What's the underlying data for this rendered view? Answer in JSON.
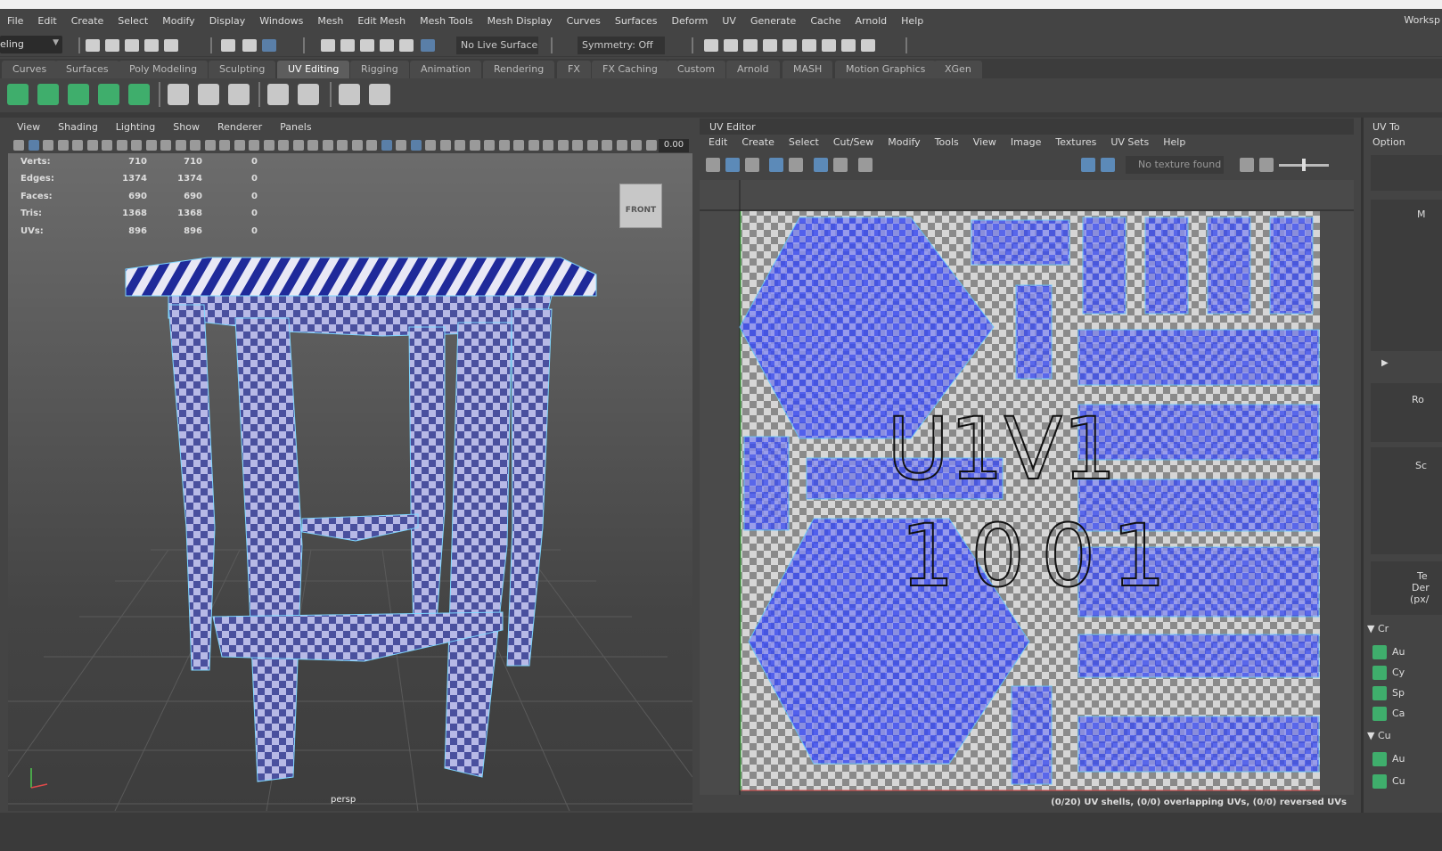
{
  "menubar": {
    "items": [
      "File",
      "Edit",
      "Create",
      "Select",
      "Modify",
      "Display",
      "Windows",
      "Mesh",
      "Edit Mesh",
      "Mesh Tools",
      "Mesh Display",
      "Curves",
      "Surfaces",
      "Deform",
      "UV",
      "Generate",
      "Cache",
      "Arnold",
      "Help"
    ],
    "workspace": "Worksp"
  },
  "statusline": {
    "mode": "eling",
    "live_surface": "No Live Surface",
    "symmetry": "Symmetry: Off"
  },
  "shelf_tabs": [
    "Curves",
    "Surfaces",
    "Poly Modeling",
    "Sculpting",
    "UV Editing",
    "Rigging",
    "Animation",
    "Rendering",
    "FX",
    "FX Caching",
    "Custom",
    "Arnold",
    "MASH",
    "Motion Graphics",
    "XGen"
  ],
  "shelf_active": "UV Editing",
  "viewport": {
    "menu": [
      "View",
      "Shading",
      "Lighting",
      "Show",
      "Renderer",
      "Panels"
    ],
    "field_value": "0.00",
    "hud": [
      {
        "label": "Verts:",
        "a": "710",
        "b": "710",
        "c": "0"
      },
      {
        "label": "Edges:",
        "a": "1374",
        "b": "1374",
        "c": "0"
      },
      {
        "label": "Faces:",
        "a": "690",
        "b": "690",
        "c": "0"
      },
      {
        "label": "Tris:",
        "a": "1368",
        "b": "1368",
        "c": "0"
      },
      {
        "label": "UVs:",
        "a": "896",
        "b": "896",
        "c": "0"
      }
    ],
    "viewcube_label": "FRONT",
    "camera": "persp"
  },
  "uv_editor": {
    "title": "UV Editor",
    "menu": [
      "Edit",
      "Create",
      "Select",
      "Cut/Sew",
      "Modify",
      "Tools",
      "View",
      "Image",
      "Textures",
      "UV Sets",
      "Help"
    ],
    "texture_status": "No texture found",
    "tile_label_top": "U1V1",
    "tile_label_bottom": "1001",
    "status": "(0/20) UV shells, (0/0) overlapping UVs, (0/0) reversed UVs"
  },
  "uv_toolkit": {
    "title": "UV To",
    "options": "Option",
    "labels": [
      "M",
      "Ro",
      "Sc",
      "Te",
      "Der",
      "(px/"
    ],
    "create_section": "Cr",
    "create_items": [
      "Au",
      "Cy",
      "Sp",
      "Ca"
    ],
    "cut_section": "Cu",
    "cut_items": [
      "Au",
      "Cu"
    ]
  },
  "colors": {
    "accent_green": "#3fae6c",
    "uv_shell_blue": "#3b4cf0",
    "checker_dark": "#3a3f9a",
    "checker_light": "#b7b9e6"
  }
}
